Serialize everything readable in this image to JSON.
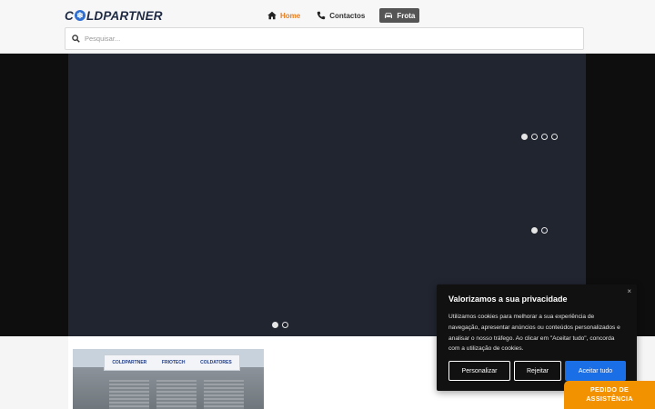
{
  "header": {
    "logo_text_before": "C",
    "logo_text_after": "LDPARTNER",
    "logo_icon": "snowflake-icon",
    "nav": [
      {
        "label": "Home",
        "icon": "home-icon",
        "active": true
      },
      {
        "label": "Contactos",
        "icon": "phone-icon",
        "active": false
      },
      {
        "label": "Frota",
        "icon": "car-icon",
        "active": false
      }
    ],
    "search": {
      "placeholder": "Pesquisar..."
    }
  },
  "hero": {
    "slider_top": {
      "count": 4,
      "active": 1
    },
    "slider_mid": {
      "count": 2,
      "active": 1
    },
    "slider_bottom": {
      "count": 2,
      "active": 1
    }
  },
  "photo": {
    "sign_texts": [
      "COLDPARTNER",
      "FRIOTECH",
      "COLDATORES"
    ]
  },
  "cookie": {
    "close": "×",
    "title": "Valorizamos a sua privacidade",
    "body": "Utilizamos cookies para melhorar a sua experiência de navegação, apresentar anúncios ou conteúdos personalizados e analisar o nosso tráfego. Ao clicar em \"Aceitar tudo\", concorda com a utilização de cookies.",
    "customize_label": "Personalizar",
    "reject_label": "Rejeitar",
    "accept_label": "Aceitar tudo"
  },
  "assist": {
    "line1": "PEDIDO DE",
    "line2": "ASSISTÊNCIA"
  },
  "colors": {
    "accent": "#f39200",
    "primary": "#1a6ee6",
    "nav_active": "#e67e22"
  }
}
